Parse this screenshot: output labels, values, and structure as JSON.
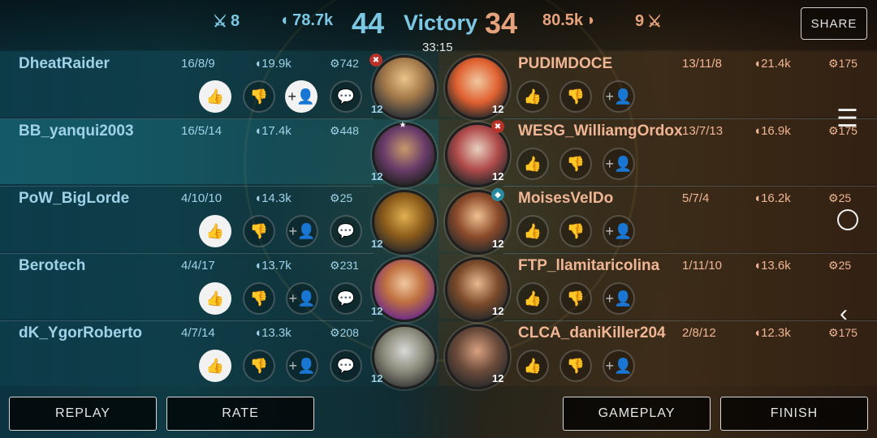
{
  "header": {
    "left_kills": "8",
    "left_gold": "78.7k",
    "left_score": "44",
    "result": "Victory",
    "right_score": "34",
    "right_gold": "80.5k",
    "right_kills": "9",
    "timer": "33:15",
    "share_label": "SHARE"
  },
  "left_team": [
    {
      "name": "DheatRaider",
      "kda": "16/8/9",
      "gold": "19.9k",
      "gems": "742",
      "level": "12"
    },
    {
      "name": "BB_yanqui2003",
      "kda": "16/5/14",
      "gold": "17.4k",
      "gems": "448",
      "level": "12"
    },
    {
      "name": "PoW_BigLorde",
      "kda": "4/10/10",
      "gold": "14.3k",
      "gems": "25",
      "level": "12"
    },
    {
      "name": "Berotech",
      "kda": "4/4/17",
      "gold": "13.7k",
      "gems": "231",
      "level": "12"
    },
    {
      "name": "dK_YgorRoberto",
      "kda": "4/7/14",
      "gold": "13.3k",
      "gems": "208",
      "level": "12"
    }
  ],
  "right_team": [
    {
      "name": "PUDIMDOCE",
      "kda": "13/11/8",
      "gold": "21.4k",
      "gems": "175",
      "level": "12"
    },
    {
      "name": "WESG_WilliamgOrdox",
      "kda": "13/7/13",
      "gold": "16.9k",
      "gems": "175",
      "level": "12"
    },
    {
      "name": "MoisesVelDo",
      "kda": "5/7/4",
      "gold": "16.2k",
      "gems": "25",
      "level": "12"
    },
    {
      "name": "FTP_llamitaricolina",
      "kda": "1/11/10",
      "gold": "13.6k",
      "gems": "25",
      "level": "12"
    },
    {
      "name": "CLCA_daniKiller204",
      "kda": "2/8/12",
      "gold": "12.3k",
      "gems": "175",
      "level": "12"
    }
  ],
  "footer": {
    "replay": "REPLAY",
    "rate": "RATE",
    "gameplay": "GAMEPLAY",
    "finish": "FINISH"
  },
  "colors": {
    "team_blue": "#7cc7e3",
    "team_orange": "#e6a27c"
  },
  "icons": [
    "kills-icon",
    "gold-icon",
    "gem-icon",
    "thumbs-up-icon",
    "thumbs-down-icon",
    "add-friend-icon",
    "chat-icon",
    "menu-icon",
    "circle-icon",
    "back-icon"
  ]
}
